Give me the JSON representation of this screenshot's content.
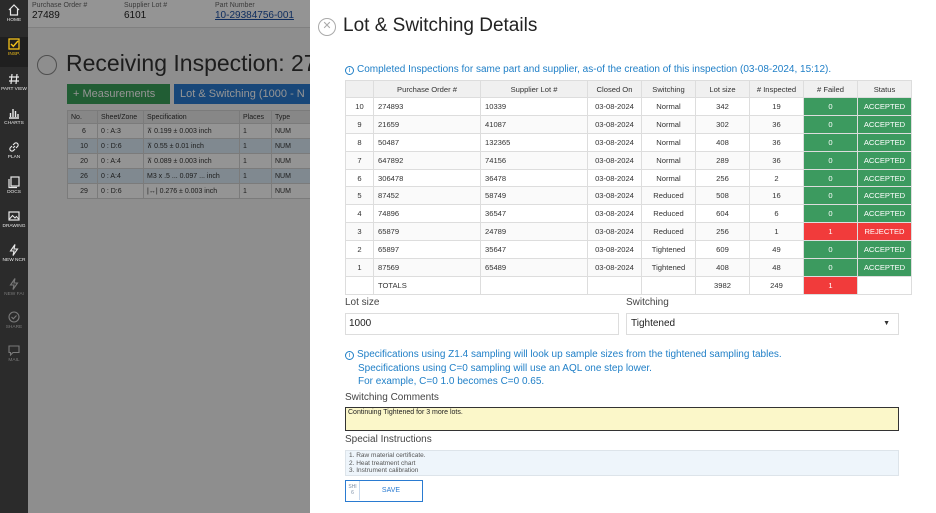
{
  "nav": {
    "items": [
      {
        "label": "HOME",
        "icon": "home-icon"
      },
      {
        "label": "INSP.",
        "icon": "checkbox-icon"
      },
      {
        "label": "PART VIEW",
        "icon": "hash-icon"
      },
      {
        "label": "CHARTS",
        "icon": "bar-chart-icon"
      },
      {
        "label": "PLAN",
        "icon": "link-icon"
      },
      {
        "label": "DOCS",
        "icon": "docs-icon"
      },
      {
        "label": "DRAWING",
        "icon": "image-icon"
      },
      {
        "label": "NEW NCR",
        "icon": "bolt-icon"
      },
      {
        "label": "NEW FAI",
        "icon": "bolt-icon"
      },
      {
        "label": "SHARE",
        "icon": "check-circle-icon"
      },
      {
        "label": "MAIL",
        "icon": "chat-icon"
      }
    ]
  },
  "background": {
    "header": {
      "purchase_order_label": "Purchase Order #",
      "purchase_order_value": "27489",
      "supplier_lot_label": "Supplier Lot #",
      "supplier_lot_value": "6101",
      "part_number_label": "Part Number",
      "part_number_value": "10-29384756-001"
    },
    "title": "Receiving Inspection: 27",
    "measurements_button": "Measurements",
    "lot_switching_button": "Lot & Switching (1000 - N",
    "table_headers": [
      "No.",
      "Sheet/Zone",
      "Specification",
      "Places",
      "Type"
    ],
    "rows": [
      {
        "no": "6",
        "zone": "0 : A:3",
        "spec": "⊼   0.199 ± 0.003  inch",
        "places": "1",
        "type": "NUM"
      },
      {
        "no": "10",
        "zone": "0 : D:6",
        "spec": "⊼   0.55 ± 0.01  inch",
        "places": "1",
        "type": "NUM"
      },
      {
        "no": "20",
        "zone": "0 : A:4",
        "spec": "⊼   0.089 ± 0.003  inch",
        "places": "1",
        "type": "NUM"
      },
      {
        "no": "26",
        "zone": "0 : A:4",
        "spec": "M3 x .5 ...  0.097 ...  inch",
        "places": "1",
        "type": "NUM"
      },
      {
        "no": "29",
        "zone": "0 : D:6",
        "spec": "|↔|  0.276 ± 0.003  inch",
        "places": "1",
        "type": "NUM"
      }
    ]
  },
  "panel": {
    "title": "Lot & Switching Details",
    "info": "Completed Inspections for same part and supplier, as-of the creation of this inspection (03-08-2024, 15:12).",
    "table": {
      "headers": [
        "",
        "Purchase Order #",
        "Supplier Lot #",
        "Closed On",
        "Switching",
        "Lot size",
        "# Inspected",
        "# Failed",
        "Status"
      ],
      "rows": [
        {
          "n": "10",
          "po": "274893",
          "lot": "10339",
          "closed": "03-08-2024",
          "switching": "Normal",
          "size": "342",
          "inspected": "19",
          "failed": "0",
          "status": "ACCEPTED",
          "ok": true
        },
        {
          "n": "9",
          "po": "21659",
          "lot": "41087",
          "closed": "03-08-2024",
          "switching": "Normal",
          "size": "302",
          "inspected": "36",
          "failed": "0",
          "status": "ACCEPTED",
          "ok": true
        },
        {
          "n": "8",
          "po": "50487",
          "lot": "132365",
          "closed": "03-08-2024",
          "switching": "Normal",
          "size": "408",
          "inspected": "36",
          "failed": "0",
          "status": "ACCEPTED",
          "ok": true
        },
        {
          "n": "7",
          "po": "647892",
          "lot": "74156",
          "closed": "03-08-2024",
          "switching": "Normal",
          "size": "289",
          "inspected": "36",
          "failed": "0",
          "status": "ACCEPTED",
          "ok": true
        },
        {
          "n": "6",
          "po": "306478",
          "lot": "36478",
          "closed": "03-08-2024",
          "switching": "Normal",
          "size": "256",
          "inspected": "2",
          "failed": "0",
          "status": "ACCEPTED",
          "ok": true
        },
        {
          "n": "5",
          "po": "87452",
          "lot": "58749",
          "closed": "03-08-2024",
          "switching": "Reduced",
          "size": "508",
          "inspected": "16",
          "failed": "0",
          "status": "ACCEPTED",
          "ok": true
        },
        {
          "n": "4",
          "po": "74896",
          "lot": "36547",
          "closed": "03-08-2024",
          "switching": "Reduced",
          "size": "604",
          "inspected": "6",
          "failed": "0",
          "status": "ACCEPTED",
          "ok": true
        },
        {
          "n": "3",
          "po": "65879",
          "lot": "24789",
          "closed": "03-08-2024",
          "switching": "Reduced",
          "size": "256",
          "inspected": "1",
          "failed": "1",
          "status": "REJECTED",
          "ok": false
        },
        {
          "n": "2",
          "po": "65897",
          "lot": "35647",
          "closed": "03-08-2024",
          "switching": "Tightened",
          "size": "609",
          "inspected": "49",
          "failed": "0",
          "status": "ACCEPTED",
          "ok": true
        },
        {
          "n": "1",
          "po": "87569",
          "lot": "65489",
          "closed": "03-08-2024",
          "switching": "Tightened",
          "size": "408",
          "inspected": "48",
          "failed": "0",
          "status": "ACCEPTED",
          "ok": true
        }
      ],
      "totals": {
        "label": "TOTALS",
        "size": "3982",
        "inspected": "249",
        "failed": "1"
      }
    },
    "lot_size_label": "Lot size",
    "lot_size_value": "1000",
    "switching_label": "Switching",
    "switching_value": "Tightened",
    "notes": [
      "Specifications using Z1.4 sampling will look up sample sizes from the tightened sampling tables.",
      "Specifications using C=0 sampling will use an AQL one step lower.",
      "For example, C=0 1.0 becomes C=0 0.65."
    ],
    "switching_comments_label": "Switching Comments",
    "switching_comments_value": "Continuing Tightened for 3 more lots.",
    "special_instructions_label": "Special Instructions",
    "special_instructions": [
      "1. Raw material certificate.",
      "2. Heat treatment chart",
      "3. Instrument calibration"
    ],
    "save_shortcut_top": "SHI",
    "save_shortcut_bottom": "6",
    "save_label": "SAVE"
  },
  "colors": {
    "accepted": "#3c9a5f",
    "rejected": "#f13b3b",
    "info_blue": "#1f7fc7",
    "accent_blue": "#2a7bd1",
    "nav_active": "#f3c11a"
  }
}
